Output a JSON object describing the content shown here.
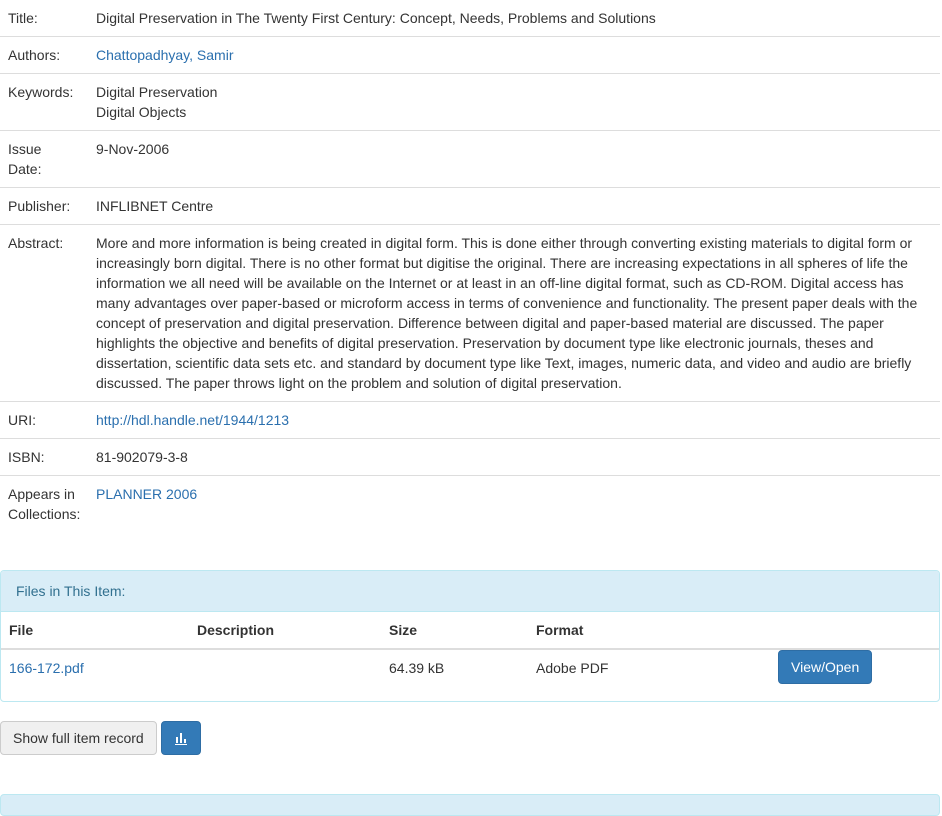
{
  "metadata": {
    "title_label": "Title:",
    "title_value": "Digital Preservation in The Twenty First Century: Concept, Needs, Problems and Solutions",
    "authors_label": "Authors:",
    "authors_value": "Chattopadhyay, Samir",
    "keywords_label": "Keywords:",
    "keywords": [
      "Digital Preservation",
      "Digital Objects"
    ],
    "issue_date_label_line1": "Issue",
    "issue_date_label_line2": "Date:",
    "issue_date_value": "9-Nov-2006",
    "publisher_label": "Publisher:",
    "publisher_value": "INFLIBNET Centre",
    "abstract_label": "Abstract:",
    "abstract_value": "More and more information is being created in digital form. This is done either through converting existing materials to digital form or increasingly born digital. There is no other format but digitise the original. There are increasing expectations in all spheres of life the information we all need will be available on the Internet or at least in an off-line digital format, such as CD-ROM. Digital access has many advantages over paper-based or microform access in terms of convenience and functionality. The present paper deals with the concept of preservation and digital preservation. Difference between digital and paper-based material are discussed. The paper highlights the objective and benefits of digital preservation. Preservation by document type like electronic journals, theses and dissertation, scientific data sets etc. and standard by document type like Text, images, numeric data, and video and audio are briefly discussed. The paper throws light on the problem and solution of digital preservation.",
    "uri_label": "URI:",
    "uri_value": "http://hdl.handle.net/1944/1213",
    "isbn_label": "ISBN:",
    "isbn_value": "81-902079-3-8",
    "collections_label_line1": "Appears in",
    "collections_label_line2": "Collections:",
    "collections_value": "PLANNER 2006"
  },
  "files": {
    "heading": "Files in This Item:",
    "columns": [
      "File",
      "Description",
      "Size",
      "Format"
    ],
    "rows": [
      {
        "file": "166-172.pdf",
        "description": "",
        "size": "64.39 kB",
        "format": "Adobe PDF",
        "action": "View/Open"
      }
    ]
  },
  "actions": {
    "full_record_label": "Show full item record",
    "stats_icon": "bar-chart-icon"
  },
  "colors": {
    "link": "#2a6fae",
    "primary": "#337ab7",
    "panel_heading_bg": "#d9edf7",
    "panel_heading_text": "#31708f"
  }
}
